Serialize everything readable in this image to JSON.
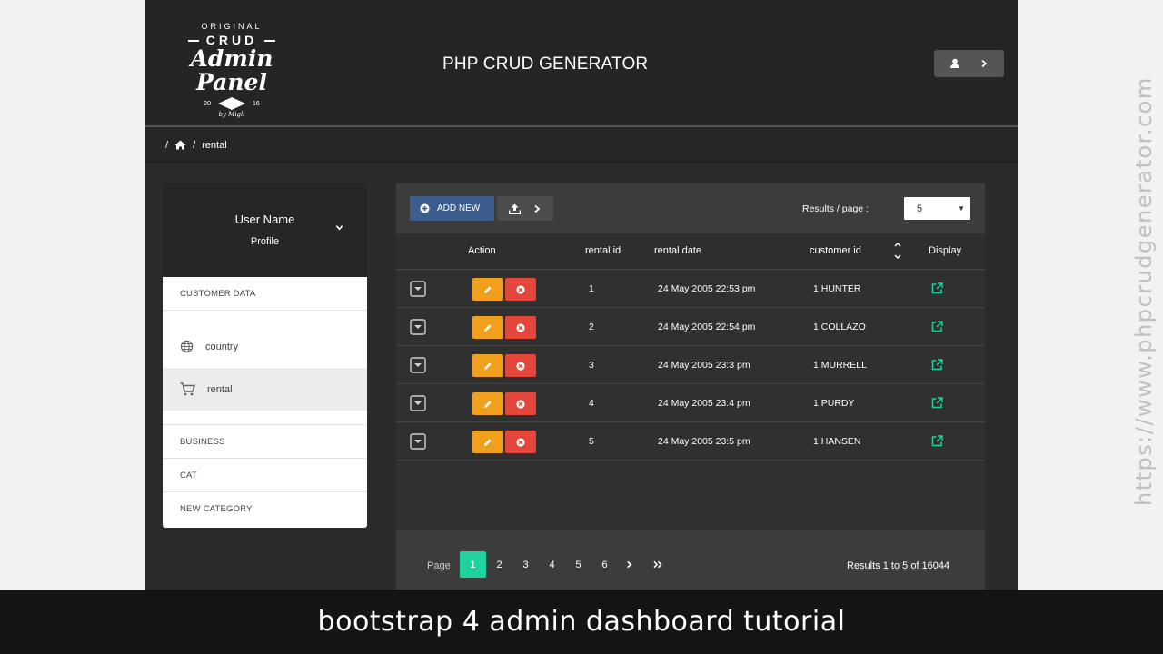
{
  "logo": {
    "line1": "ORIGINAL",
    "line2": "CRUD",
    "line3": "Admin Panel",
    "year_left": "20",
    "year_right": "16",
    "byline": "by Migli"
  },
  "header": {
    "title": "PHP CRUD GENERATOR"
  },
  "breadcrumb": {
    "sep1": "/",
    "sep2": "/",
    "current": "rental"
  },
  "sidebar": {
    "user_name": "User Name",
    "profile_label": "Profile",
    "section_customer": "CUSTOMER DATA",
    "item_country": "country",
    "item_rental": "rental",
    "section_business": "BUSINESS",
    "section_cat": "CAT",
    "section_new_category": "NEW CATEGORY"
  },
  "toolbar": {
    "add_new_label": "ADD NEW",
    "results_per_page_label": "Results / page :",
    "results_per_page_value": "5"
  },
  "table": {
    "columns": {
      "action": "Action",
      "rental_id": "rental id",
      "rental_date": "rental date",
      "customer_id": "customer id",
      "display": "Display"
    },
    "rows": [
      {
        "rental_id": "1",
        "rental_date": "24 May 2005 22:53 pm",
        "customer_id": "1 HUNTER"
      },
      {
        "rental_id": "2",
        "rental_date": "24 May 2005 22:54 pm",
        "customer_id": "1 COLLAZO"
      },
      {
        "rental_id": "3",
        "rental_date": "24 May 2005 23:3 pm",
        "customer_id": "1 MURRELL"
      },
      {
        "rental_id": "4",
        "rental_date": "24 May 2005 23:4 pm",
        "customer_id": "1 PURDY"
      },
      {
        "rental_id": "5",
        "rental_date": "24 May 2005 23:5 pm",
        "customer_id": "1 HANSEN"
      }
    ]
  },
  "pagination": {
    "label": "Page",
    "pages": [
      "1",
      "2",
      "3",
      "4",
      "5",
      "6"
    ],
    "active_page": "1",
    "results_text": "Results 1 to 5 of 16044"
  },
  "caption": "bootstrap 4 admin dashboard tutorial",
  "watermark": "https://www.phpcrudgenerator.com",
  "colors": {
    "add_button": "#3d5e8c",
    "edit_button": "#f0a01d",
    "delete_button": "#e5463c",
    "active_page": "#1fd19e",
    "display_icon": "#1fd19e"
  }
}
